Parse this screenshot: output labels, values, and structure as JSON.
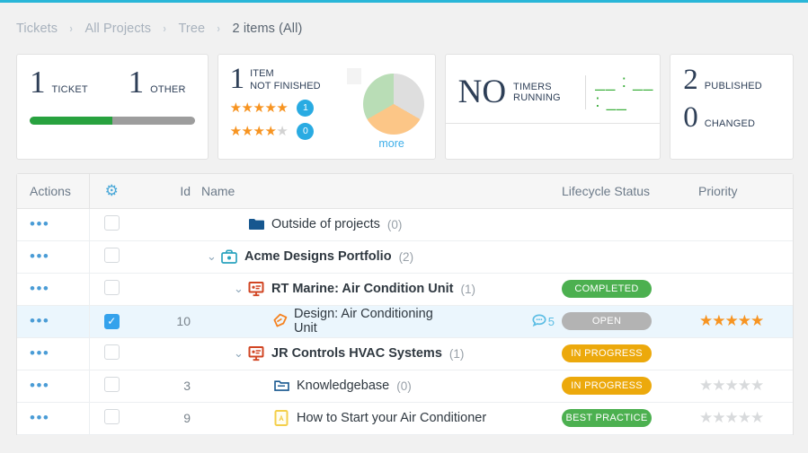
{
  "theme": {
    "accent": "#29b6d8",
    "link": "#3daee9",
    "green": "#4cb050",
    "amber": "#eca90c",
    "gray_badge": "#b3b3b3",
    "star": "#f79421",
    "checkbox_on": "#34a2ec"
  },
  "breadcrumb": {
    "items": [
      "Tickets",
      "All Projects",
      "Tree",
      "2 items (All)"
    ],
    "separator": "›"
  },
  "cards": {
    "tickets": {
      "count": "1",
      "label": "TICKET",
      "other_count": "1",
      "other_label": "OTHER",
      "progress_percent": 50
    },
    "items": {
      "count": "1",
      "label_line1": "ITEM",
      "label_line2": "NOT FINISHED",
      "ratings": [
        {
          "filled": 5,
          "total": 5,
          "badge": "1"
        },
        {
          "filled": 4,
          "total": 5,
          "badge": "0"
        }
      ],
      "more_label": "more",
      "pie": {
        "slices": [
          {
            "color": "#dedede",
            "percent": 33.3
          },
          {
            "color": "#fcc687",
            "percent": 33.3
          },
          {
            "color": "#b9ddb6",
            "percent": 33.4
          }
        ]
      }
    },
    "timers": {
      "count": "NO",
      "label": "TIMERS RUNNING",
      "display": "__ : __ : __"
    },
    "publish": {
      "published_count": "2",
      "published_label": "PUBLISHED",
      "changed_count": "0",
      "changed_label": "CHANGED"
    }
  },
  "table": {
    "headers": {
      "actions": "Actions",
      "settings_icon": "gear-icon",
      "id": "Id",
      "name": "Name",
      "status": "Lifecycle Status",
      "priority": "Priority"
    },
    "rows": [
      {
        "id": "",
        "indent": 1,
        "chevron": "",
        "icon": "folder-solid-icon",
        "name": "Outside of projects",
        "count": "(0)",
        "bold": false,
        "checked": false,
        "selected": false,
        "status": "",
        "status_class": "",
        "stars_filled": null,
        "comments": ""
      },
      {
        "id": "",
        "indent": 0,
        "chevron": "⌄",
        "icon": "portfolio-icon",
        "name": "Acme Designs  Portfolio",
        "count": "(2)",
        "bold": true,
        "checked": false,
        "selected": false,
        "status": "",
        "status_class": "",
        "stars_filled": null,
        "comments": ""
      },
      {
        "id": "",
        "indent": 1,
        "chevron": "⌄",
        "icon": "project-board-icon",
        "name": "RT Marine: Air Condition Unit",
        "count": "(1)",
        "bold": true,
        "checked": false,
        "selected": false,
        "status": "COMPLETED",
        "status_class": "b-green",
        "stars_filled": null,
        "comments": ""
      },
      {
        "id": "10",
        "indent": 2,
        "chevron": "",
        "icon": "task-ribbon-icon",
        "name": "Design: Air Conditioning Unit",
        "count": "",
        "bold": false,
        "checked": true,
        "selected": true,
        "status": "OPEN",
        "status_class": "b-gray",
        "stars_filled": 5,
        "comments": "5"
      },
      {
        "id": "",
        "indent": 1,
        "chevron": "⌄",
        "icon": "project-board-icon",
        "name": "JR Controls HVAC Systems",
        "count": "(1)",
        "bold": true,
        "checked": false,
        "selected": false,
        "status": "IN PROGRESS",
        "status_class": "b-amber",
        "stars_filled": null,
        "comments": ""
      },
      {
        "id": "3",
        "indent": 2,
        "chevron": "",
        "icon": "folder-outline-icon",
        "name": "Knowledgebase",
        "count": "(0)",
        "bold": false,
        "checked": false,
        "selected": false,
        "status": "IN PROGRESS",
        "status_class": "b-amber",
        "stars_filled": 0,
        "comments": ""
      },
      {
        "id": "9",
        "indent": 2,
        "chevron": "",
        "icon": "document-icon",
        "name": "How to Start your Air Conditioner",
        "count": "",
        "bold": false,
        "checked": false,
        "selected": false,
        "status": "BEST PRACTICE",
        "status_class": "b-green",
        "stars_filled": 0,
        "comments": ""
      }
    ],
    "actions_glyph": "•••",
    "check_glyph": "✓"
  }
}
